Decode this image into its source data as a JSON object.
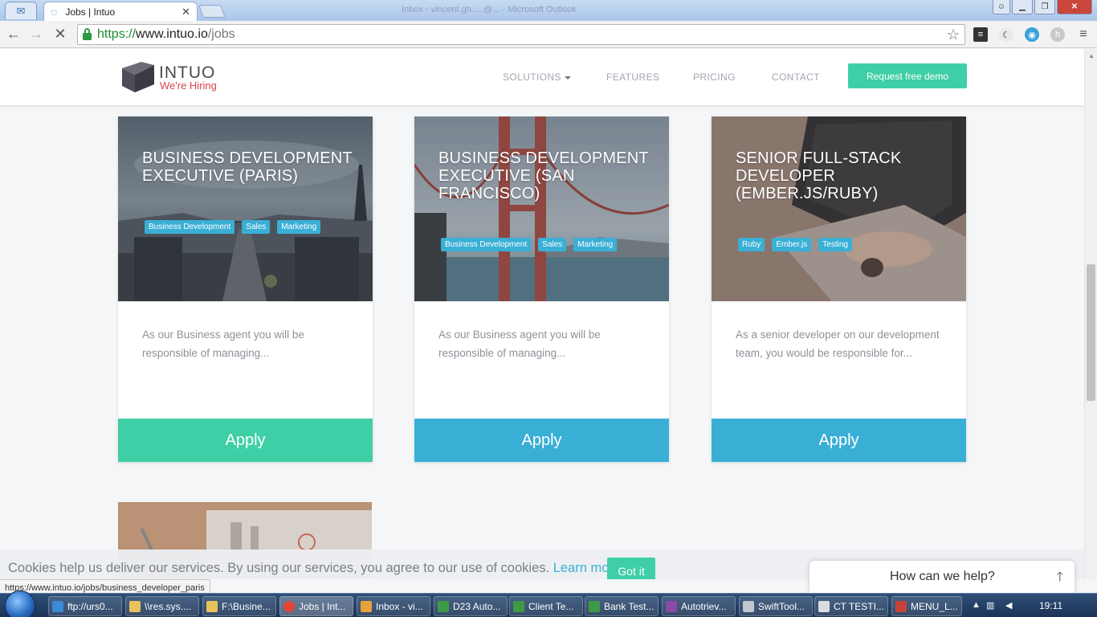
{
  "browser": {
    "tab_title": "Jobs | Intuo",
    "url_scheme": "https://",
    "url_host": "www.intuo.io",
    "url_path": "/jobs",
    "blurred_title": "Inbox - vincent.gh.....@... - Microsoft Outlook"
  },
  "site": {
    "logo_name": "INTUO",
    "logo_tagline": "We're Hiring",
    "nav": {
      "solutions": "SOLUTIONS",
      "features": "FEATURES",
      "pricing": "PRICING",
      "contact": "CONTACT"
    },
    "demo_button": "Request free demo"
  },
  "jobs": [
    {
      "title": "BUSINESS DEVELOPMENT EXECUTIVE (PARIS)",
      "tags": [
        "Business Development",
        "Sales",
        "Marketing"
      ],
      "description": "As our Business agent you will be responsible of managing...",
      "apply": "Apply",
      "apply_color": "#3fcfa6"
    },
    {
      "title": "BUSINESS DEVELOPMENT EXECUTIVE (SAN FRANCISCO)",
      "tags": [
        "Business Development",
        "Sales",
        "Marketing"
      ],
      "description": "As our Business agent you will be responsible of managing...",
      "apply": "Apply",
      "apply_color": "#3aafd6"
    },
    {
      "title": "SENIOR FULL-STACK DEVELOPER (EMBER.JS/RUBY)",
      "tags": [
        "Ruby",
        "Ember.js",
        "Testing"
      ],
      "description": "As a senior developer on our development team, you would be responsible for...",
      "apply": "Apply",
      "apply_color": "#3aafd6"
    }
  ],
  "cookie": {
    "text": "Cookies help us deliver our services. By using our services, you agree to our use of cookies.",
    "link": "Learn more.",
    "button": "Got it"
  },
  "status_url": "https://www.intuo.io/jobs/business_developer_paris",
  "help_widget": "How can we help?",
  "taskbar": {
    "items": [
      "ftp://urs0...",
      "\\\\res.sys....",
      "F:\\Busine...",
      "Jobs | Int...",
      "Inbox - vi...",
      "D23 Auto...",
      "Client Te...",
      "Bank Test...",
      "Autotriev...",
      "SwiftTool...",
      "CT TESTI...",
      "MENU_L..."
    ],
    "clock": "19:11"
  },
  "colors": {
    "accent_green": "#3fcfa6",
    "accent_blue": "#3aafd6",
    "brand_red": "#d9434c"
  }
}
